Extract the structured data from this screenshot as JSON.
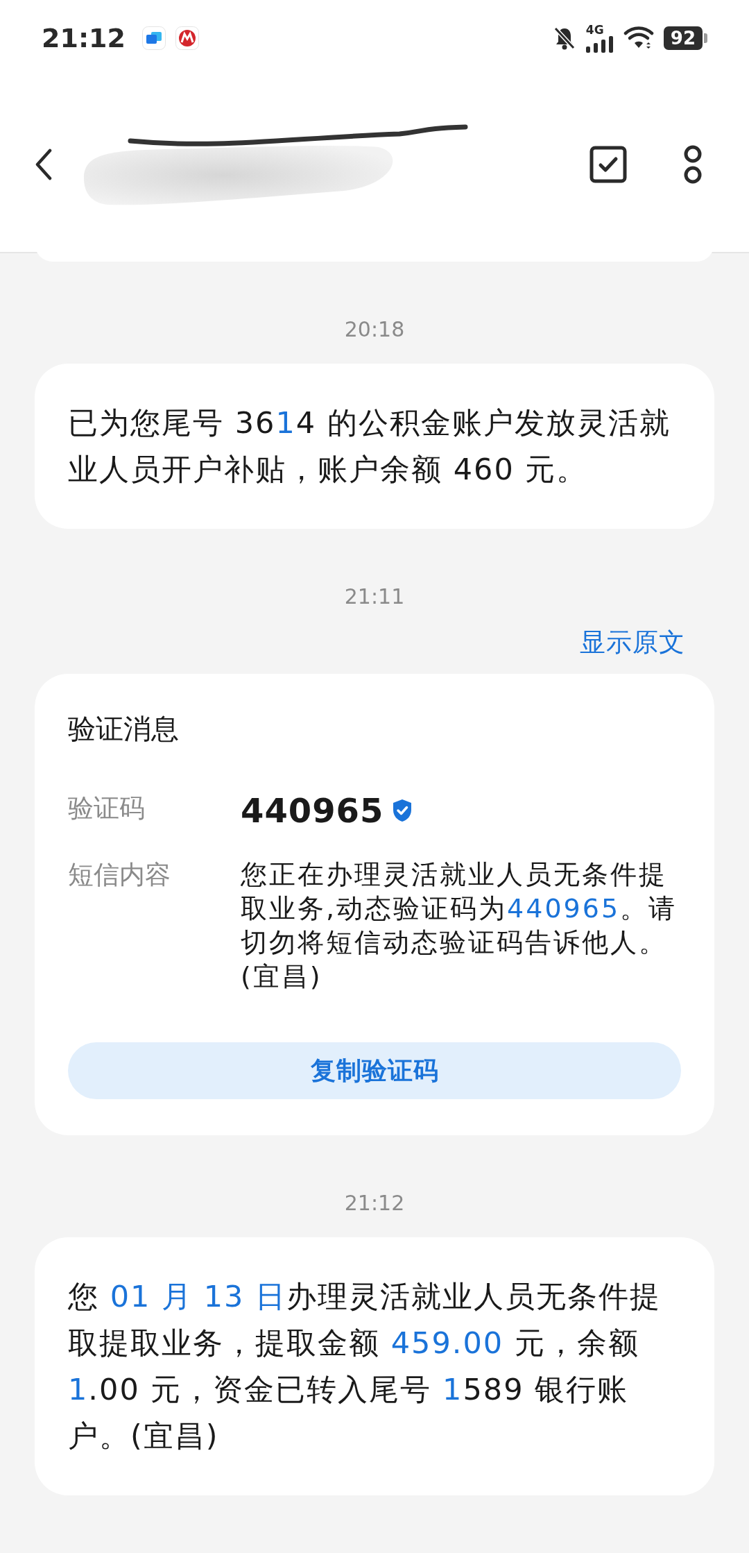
{
  "status_bar": {
    "time": "21:12",
    "network": "4G",
    "battery": "92"
  },
  "messages": [
    {
      "kind": "sms",
      "time": "20:18",
      "segments": [
        {
          "text": "已为您尾号 36",
          "kind": "plain"
        },
        {
          "text": "1",
          "kind": "link"
        },
        {
          "text": "4 的公积金账户发放灵活就业人员开户补贴，账户余额 460 元。",
          "kind": "plain"
        }
      ]
    },
    {
      "kind": "verification",
      "time": "21:11",
      "show_original": "显示原文",
      "title": "验证消息",
      "code_label": "验证码",
      "code": "440965",
      "content_label": "短信内容",
      "segments": [
        {
          "text": "您正在办理灵活就业人员无条件提取业务,动态验证码为",
          "kind": "plain"
        },
        {
          "text": "440965",
          "kind": "link"
        },
        {
          "text": "。请切勿将短信动态验证码告诉他人。(宜昌)",
          "kind": "plain"
        }
      ],
      "copy_button": "复制验证码"
    },
    {
      "kind": "sms",
      "time": "21:12",
      "segments": [
        {
          "text": "您 ",
          "kind": "plain"
        },
        {
          "text": "01 月 13 日",
          "kind": "link"
        },
        {
          "text": "办理灵活就业人员无条件提取提取业务，提取金额 ",
          "kind": "plain"
        },
        {
          "text": "459.00",
          "kind": "link"
        },
        {
          "text": " 元，余额 ",
          "kind": "plain"
        },
        {
          "text": "1",
          "kind": "link"
        },
        {
          "text": ".00 元，资金已转入尾号 ",
          "kind": "plain"
        },
        {
          "text": "1",
          "kind": "link"
        },
        {
          "text": "589 银行账户。(宜昌)",
          "kind": "plain"
        }
      ]
    }
  ]
}
